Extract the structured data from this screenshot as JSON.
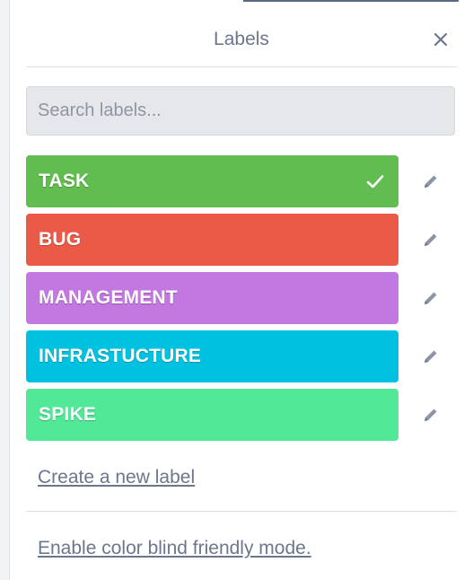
{
  "popover": {
    "title": "Labels",
    "close_icon": "close-icon"
  },
  "search": {
    "placeholder": "Search labels...",
    "value": ""
  },
  "labels": [
    {
      "name": "TASK",
      "color": "#61bd4f",
      "selected": true
    },
    {
      "name": "BUG",
      "color": "#eb5a46",
      "selected": false
    },
    {
      "name": "MANAGEMENT",
      "color": "#c377e0",
      "selected": false
    },
    {
      "name": "INFRASTUCTURE",
      "color": "#00c2e0",
      "selected": false
    },
    {
      "name": "SPIKE",
      "color": "#51e898",
      "selected": false
    }
  ],
  "actions": {
    "create_label": "Create a new label",
    "color_blind_mode": "Enable color blind friendly mode."
  },
  "icons": {
    "selected": "check-icon",
    "edit": "pencil-icon"
  }
}
